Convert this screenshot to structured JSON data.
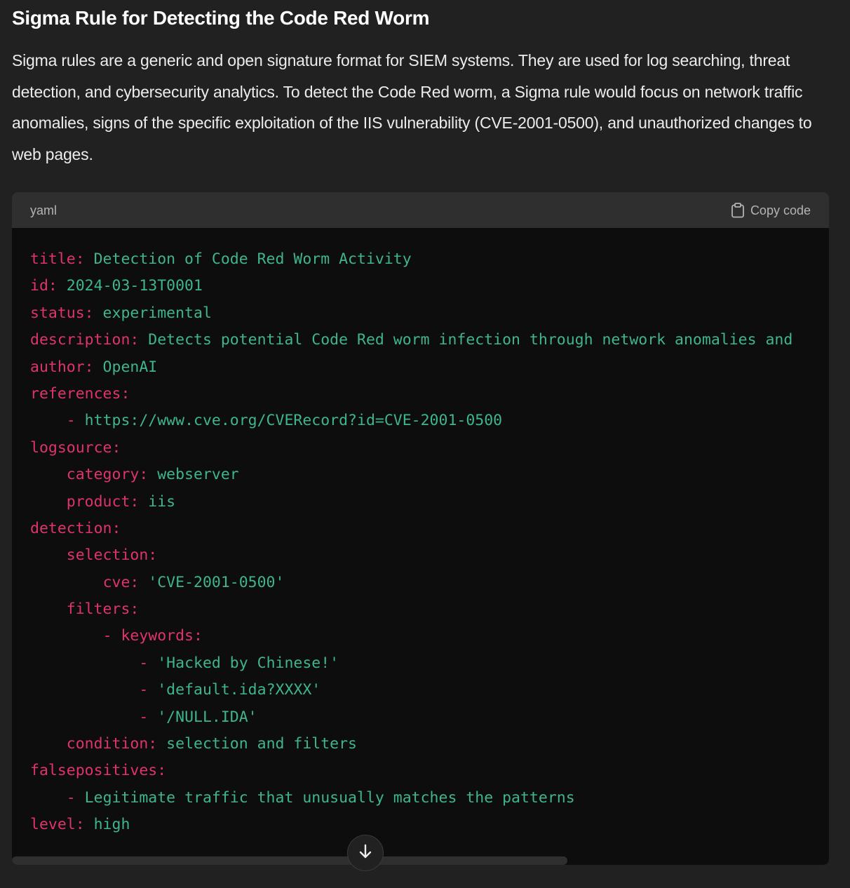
{
  "message": {
    "heading": "Sigma Rule for Detecting the Code Red Worm",
    "paragraph": "Sigma rules are a generic and open signature format for SIEM systems. They are used for log searching, threat detection, and cybersecurity analytics. To detect the Code Red worm, a Sigma rule would focus on network traffic anomalies, signs of the specific exploitation of the IIS vulnerability (CVE-2001-0500), and unauthorized changes to web pages."
  },
  "code_block": {
    "language": "yaml",
    "copy_label": "Copy code",
    "copy_icon": "clipboard-icon",
    "lines": [
      {
        "indent": "",
        "key": "title:",
        "value": " Detection of Code Red Worm Activity"
      },
      {
        "indent": "",
        "key": "id:",
        "value": " 2024-03-13T0001"
      },
      {
        "indent": "",
        "key": "status:",
        "value": " experimental"
      },
      {
        "indent": "",
        "key": "description:",
        "value": " Detects potential Code Red worm infection through network anomalies and"
      },
      {
        "indent": "",
        "key": "author:",
        "value": " OpenAI"
      },
      {
        "indent": "",
        "key": "references:",
        "value": ""
      },
      {
        "indent": "    ",
        "key": "-",
        "value": " https://www.cve.org/CVERecord?id=CVE-2001-0500"
      },
      {
        "indent": "",
        "key": "logsource:",
        "value": ""
      },
      {
        "indent": "    ",
        "key": "category:",
        "value": " webserver"
      },
      {
        "indent": "    ",
        "key": "product:",
        "value": " iis"
      },
      {
        "indent": "",
        "key": "detection:",
        "value": ""
      },
      {
        "indent": "    ",
        "key": "selection:",
        "value": ""
      },
      {
        "indent": "        ",
        "key": "cve:",
        "value": " 'CVE-2001-0500'"
      },
      {
        "indent": "    ",
        "key": "filters:",
        "value": ""
      },
      {
        "indent": "        ",
        "key": "- keywords:",
        "value": ""
      },
      {
        "indent": "            ",
        "key": "-",
        "value": " 'Hacked by Chinese!'"
      },
      {
        "indent": "            ",
        "key": "-",
        "value": " 'default.ida?XXXX'"
      },
      {
        "indent": "            ",
        "key": "-",
        "value": " '/NULL.IDA'"
      },
      {
        "indent": "    ",
        "key": "condition:",
        "value": " selection and filters"
      },
      {
        "indent": "",
        "key": "falsepositives:",
        "value": ""
      },
      {
        "indent": "    ",
        "key": "-",
        "value": " Legitimate traffic that unusually matches the patterns"
      },
      {
        "indent": "",
        "key": "level:",
        "value": " high"
      }
    ],
    "horizontal_scroll_fraction": 0.68
  },
  "scroll_down_icon": "arrow-down-icon",
  "colors": {
    "background": "#212121",
    "code_background": "#0d0d0d",
    "code_header": "#2f2f2f",
    "yaml_key": "#e0336b",
    "yaml_value": "#3fb58e"
  }
}
